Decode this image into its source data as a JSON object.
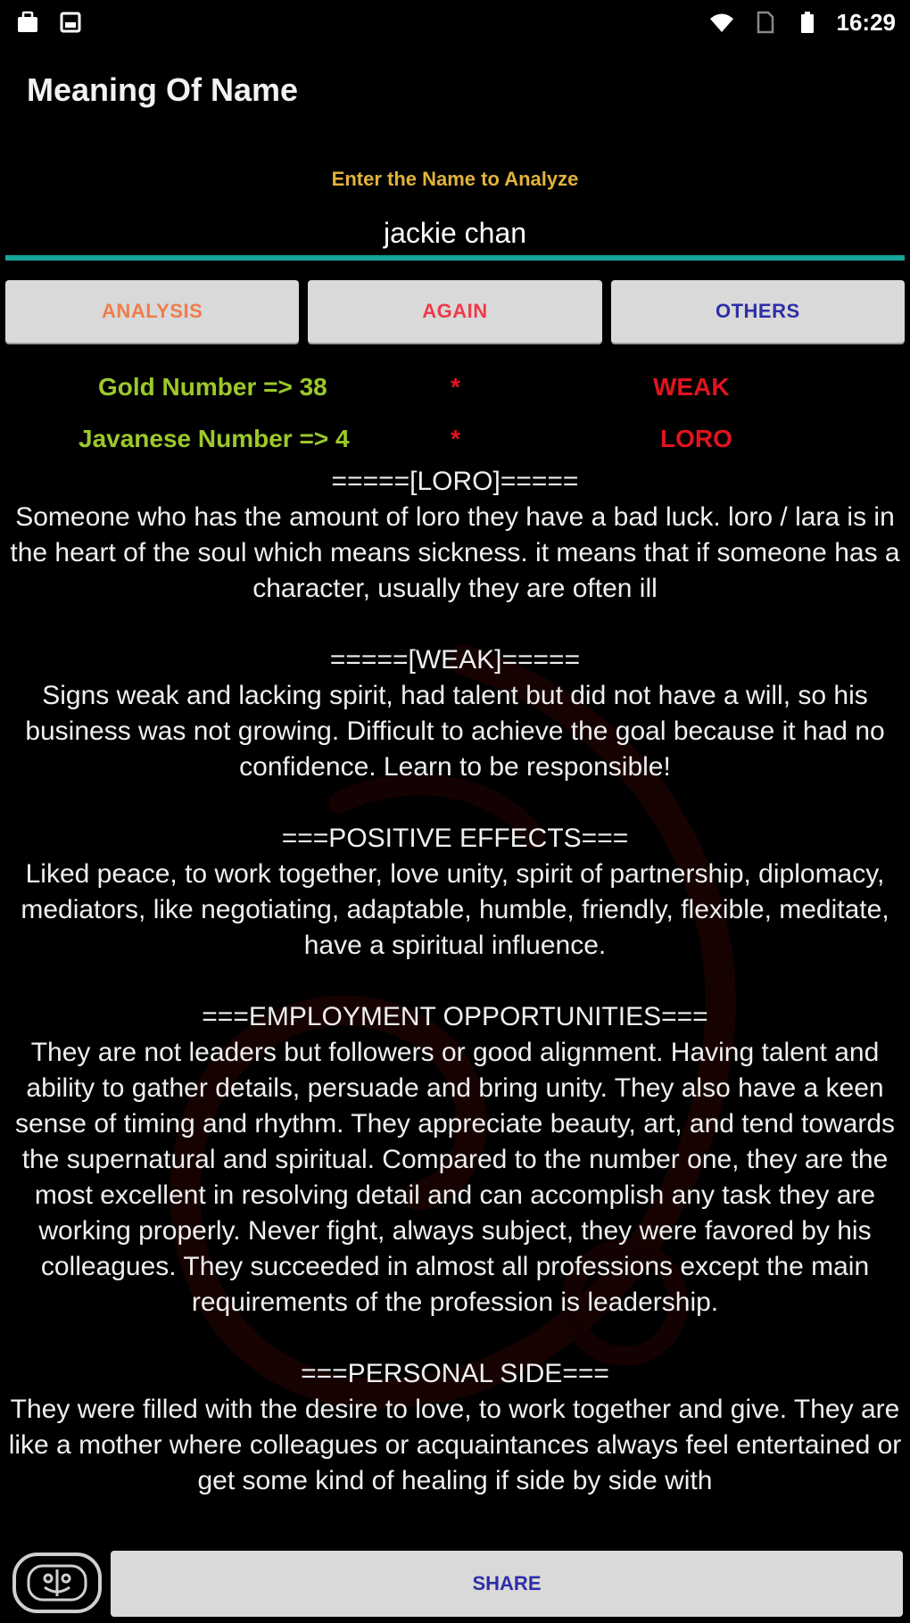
{
  "status_bar": {
    "time": "16:29",
    "left_icons": [
      "briefcase-icon",
      "photo-icon"
    ],
    "right_icons": [
      "wifi-icon",
      "sim-icon",
      "battery-icon"
    ]
  },
  "header": {
    "title": "Meaning Of Name"
  },
  "input": {
    "label": "Enter the Name to Analyze",
    "value": "jackie chan"
  },
  "buttons": {
    "analysis": "ANALYSIS",
    "again": "AGAIN",
    "others": "OTHERS"
  },
  "results": {
    "gold_label": "Gold Number => 38",
    "gold_star": "*",
    "gold_value": "WEAK",
    "javanese_label": "Javanese Number => 4",
    "javanese_star": "*",
    "javanese_value": "LORO"
  },
  "sections": [
    {
      "heading": "=====[LORO]=====",
      "text": "Someone who has the amount of loro they have a bad luck. loro / lara is in the heart of the soul which means sickness. it means that if someone has a character, usually they are often ill"
    },
    {
      "heading": "=====[WEAK]=====",
      "text": "Signs weak and lacking spirit, had talent but did not have a will, so his business was not growing. Difficult to achieve the goal because it had no confidence. Learn to be responsible!"
    },
    {
      "heading": "===POSITIVE EFFECTS===",
      "text": "Liked peace, to work together, love unity, spirit of partnership, diplomacy, mediators, like negotiating, adaptable, humble, friendly, flexible, meditate, have a spiritual influence."
    },
    {
      "heading": "===EMPLOYMENT OPPORTUNITIES===",
      "text": "They are not leaders but followers or good alignment. Having talent and ability to gather details, persuade and bring unity. They also have a keen sense of timing and rhythm. They appreciate beauty, art, and tend towards the supernatural and spiritual. Compared to the number one, they are the most excellent in resolving detail and can accomplish any task they are working properly. Never fight, always subject, they were favored by his colleagues. They succeeded in almost all professions except the main requirements of the profession is leadership."
    },
    {
      "heading": "===PERSONAL SIDE===",
      "text": "They were filled with the desire to love, to work together and give. They are like a mother where colleagues or acquaintances always feel entertained or get some kind of healing if side by side with"
    }
  ],
  "bottom_bar": {
    "emoji_icon": "emoji-icon",
    "share": "SHARE"
  },
  "colors": {
    "background": "#000000",
    "accent_line": "#16a59a",
    "label_gold": "#e2b23b",
    "number_green": "#9cc92a",
    "value_red": "#e0141e",
    "analysis_text": "#ef7d4a",
    "again_text": "#ef3a4a",
    "others_text": "#2e2ea8",
    "button_bg": "#d9d9d9"
  }
}
